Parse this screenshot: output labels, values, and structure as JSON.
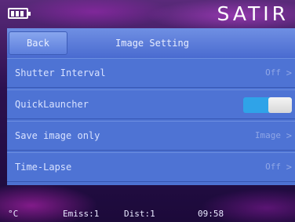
{
  "brand": "SATIR",
  "header": {
    "back_label": "Back",
    "title": "Image Setting"
  },
  "rows": [
    {
      "label": "Shutter Interval",
      "value": "Off"
    },
    {
      "label": "QuickLauncher",
      "toggle_on": true
    },
    {
      "label": "Save image only",
      "value": "Image"
    },
    {
      "label": "Time-Lapse",
      "value": "Off"
    }
  ],
  "status": {
    "unit": "°C",
    "emiss": "Emiss:1",
    "dist": "Dist:1",
    "time": "09:58"
  },
  "colors": {
    "panel": "#4d72d2",
    "toggle_on": "#2fa3e8",
    "value_text": "#8fa6e6"
  },
  "icons": {
    "battery": "battery-icon",
    "chevron": "chevron-right-icon"
  }
}
